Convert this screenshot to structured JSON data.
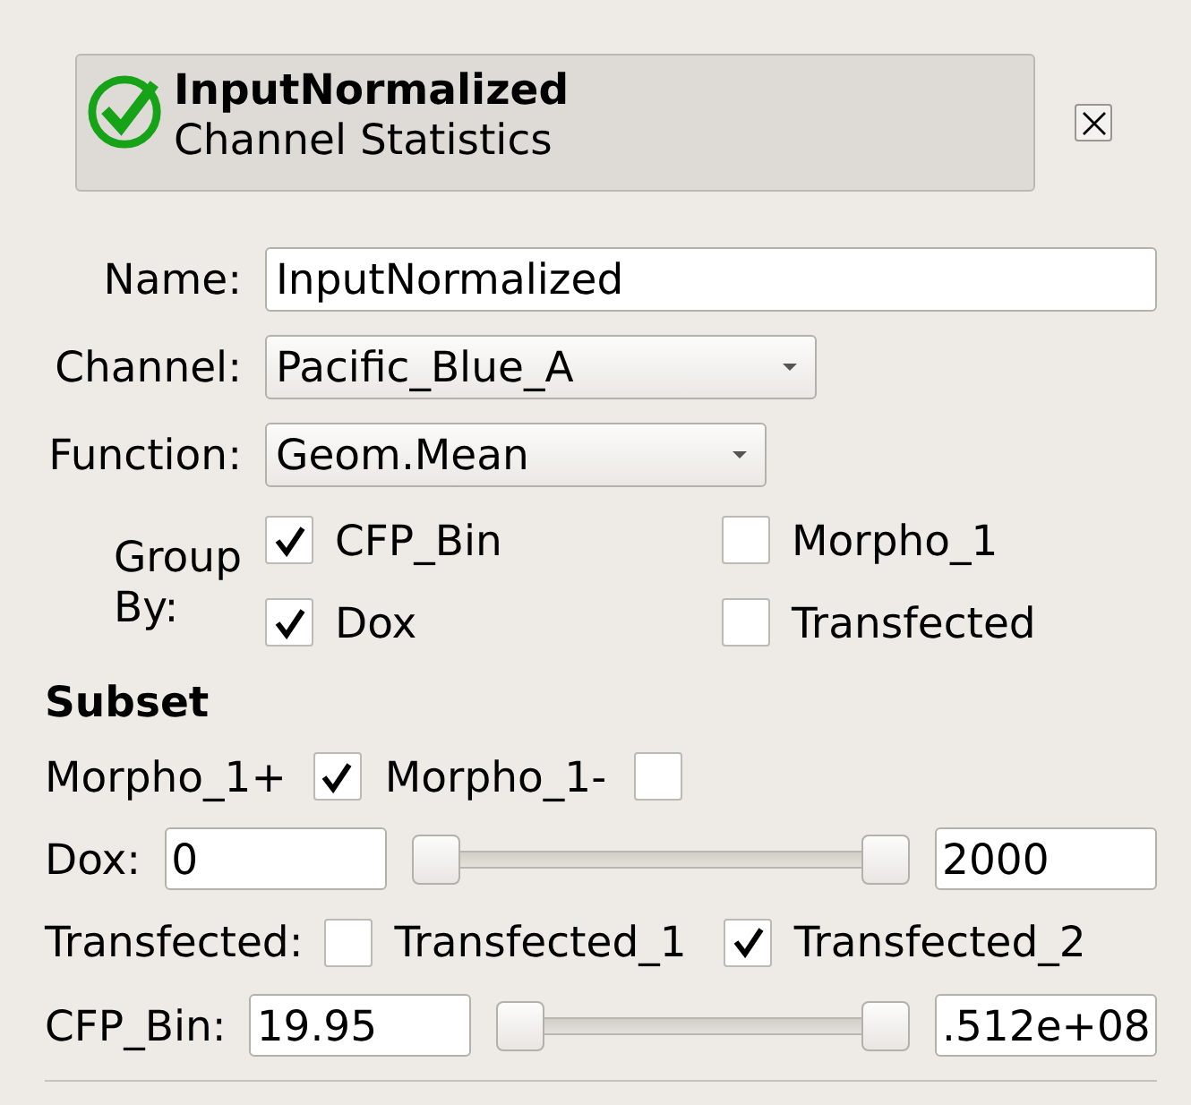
{
  "header": {
    "title": "InputNormalized",
    "subtitle": "Channel Statistics"
  },
  "form": {
    "name": {
      "label": "Name:",
      "value": "InputNormalized"
    },
    "channel": {
      "label": "Channel:",
      "value": "Pacific_Blue_A"
    },
    "function": {
      "label": "Function:",
      "value": "Geom.Mean"
    },
    "group_by": {
      "label": "Group By:",
      "options": [
        {
          "label": "CFP_Bin",
          "checked": true
        },
        {
          "label": "Morpho_1",
          "checked": false
        },
        {
          "label": "Dox",
          "checked": true
        },
        {
          "label": "Transfected",
          "checked": false
        }
      ]
    }
  },
  "subset": {
    "title": "Subset",
    "rows": [
      {
        "kind": "inline-checks",
        "items": [
          {
            "label": "Morpho_1+",
            "checked": true
          },
          {
            "label": "Morpho_1-",
            "checked": false
          }
        ]
      },
      {
        "kind": "range",
        "label": "Dox:",
        "min_value": "0",
        "max_value": "2000",
        "handles": [
          {
            "level": 0
          },
          {
            "level": 1
          }
        ]
      },
      {
        "kind": "labeled-checks",
        "label": "Transfected:",
        "items": [
          {
            "label": "Transfected_1",
            "checked": false
          },
          {
            "label": "Transfected_2",
            "checked": true
          }
        ]
      },
      {
        "kind": "range",
        "label": "CFP_Bin:",
        "min_value": "19.95",
        "max_value": ".512e+08",
        "handles": [
          {
            "level": 0
          },
          {
            "level": 1
          }
        ]
      }
    ]
  }
}
